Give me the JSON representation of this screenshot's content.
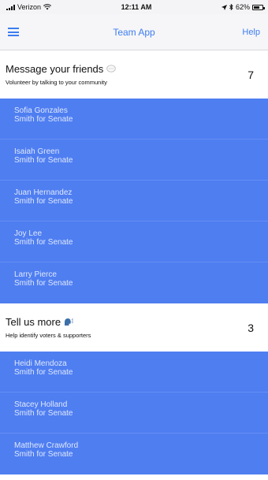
{
  "status_bar": {
    "carrier": "Verizon",
    "time": "12:11 AM",
    "battery": "62%",
    "icons": [
      "signal-icon",
      "wifi-icon",
      "location-icon",
      "bluetooth-icon",
      "battery-icon"
    ]
  },
  "nav": {
    "title": "Team App",
    "help_label": "Help",
    "menu_icon": "hamburger-menu-icon"
  },
  "sections": [
    {
      "title": "Message your friends",
      "subtitle": "Volunteer by talking to your community",
      "count": "7",
      "icon": "chat-bubble-icon",
      "items": [
        {
          "name": "Sofia Gonzales",
          "campaign": "Smith for Senate"
        },
        {
          "name": "Isaiah Green",
          "campaign": "Smith for Senate"
        },
        {
          "name": "Juan Hernandez",
          "campaign": "Smith for Senate"
        },
        {
          "name": "Joy Lee",
          "campaign": "Smith for Senate"
        },
        {
          "name": "Larry Pierce",
          "campaign": "Smith for Senate"
        }
      ]
    },
    {
      "title": "Tell us more",
      "subtitle": "Help identify voters & supporters",
      "count": "3",
      "icon": "speaking-head-icon",
      "items": [
        {
          "name": "Heidi Mendoza",
          "campaign": "Smith for Senate"
        },
        {
          "name": "Stacey Holland",
          "campaign": "Smith for Senate"
        },
        {
          "name": "Matthew Crawford",
          "campaign": "Smith for Senate"
        }
      ]
    }
  ],
  "colors": {
    "accent": "#3d7df0",
    "list_background": "#4f7ef1",
    "list_text": "#dfe8fd"
  }
}
